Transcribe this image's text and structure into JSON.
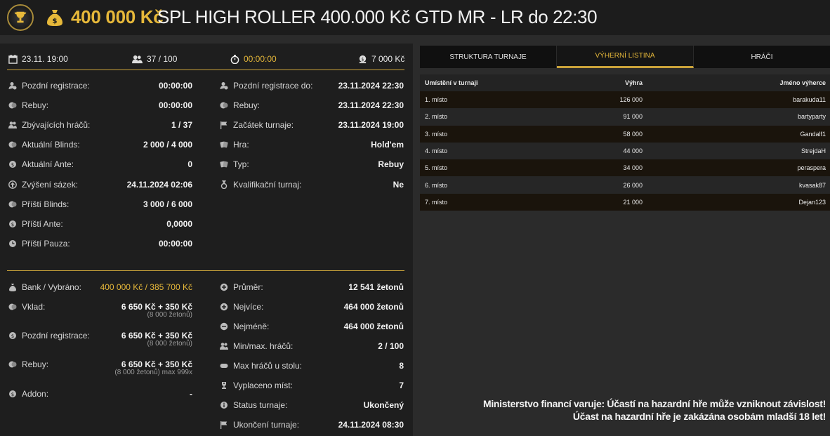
{
  "header": {
    "prize": "400 000 Kč",
    "title": "SPL HIGH ROLLER 400.000 Kč GTD MR - LR do 22:30"
  },
  "topstats": {
    "date": "23.11. 19:00",
    "players": "37 / 100",
    "timer": "00:00:00",
    "buyin": "7 000 Kč"
  },
  "left_col": [
    {
      "label": "Pozdní registrace:",
      "value": "00:00:00",
      "icon": "user-clock-icon"
    },
    {
      "label": "Rebuy:",
      "value": "00:00:00",
      "icon": "coins-icon"
    },
    {
      "label": "Zbývajících hráčů:",
      "value": "1 / 37",
      "icon": "users-icon"
    },
    {
      "label": "Aktuální Blinds:",
      "value": "2 000 / 4 000",
      "icon": "coins-icon"
    },
    {
      "label": "Aktuální Ante:",
      "value": "0",
      "icon": "coin-icon"
    },
    {
      "label": "Zvýšení sázek:",
      "value": "24.11.2024 02:06",
      "icon": "arrow-up-icon"
    },
    {
      "label": "Příští Blinds:",
      "value": "3 000 / 6 000",
      "icon": "coins-icon"
    },
    {
      "label": "Příští Ante:",
      "value": "0,0000",
      "icon": "coin-icon"
    },
    {
      "label": "Příští Pauza:",
      "value": "00:00:00",
      "icon": "clock-icon"
    }
  ],
  "right_col": [
    {
      "label": "Pozdní registrace do:",
      "value": "23.11.2024 22:30",
      "icon": "user-clock-icon"
    },
    {
      "label": "Rebuy:",
      "value": "23.11.2024 22:30",
      "icon": "coins-icon"
    },
    {
      "label": "Začátek turnaje:",
      "value": "23.11.2024 19:00",
      "icon": "flag-icon"
    },
    {
      "label": "Hra:",
      "value": "Hold'em",
      "icon": "cards-icon"
    },
    {
      "label": "Typ:",
      "value": "Rebuy",
      "icon": "cards-icon"
    },
    {
      "label": "Kvalifikační turnaj:",
      "value": "Ne",
      "icon": "medal-icon"
    }
  ],
  "bank": {
    "label": "Bank / Vybráno:",
    "value": "400 000 Kč / 385 700 Kč",
    "vklad_label": "Vklad:",
    "vklad_value": "6 650 Kč + 350 Kč",
    "vklad_sub": "(8 000 žetonů)",
    "late_label": "Pozdní registrace:",
    "late_value": "6 650 Kč + 350 Kč",
    "late_sub": "(8 000 žetonů)",
    "rebuy_label": "Rebuy:",
    "rebuy_value": "6 650 Kč + 350 Kč",
    "rebuy_sub": "(8 000 žetonů) max 999x",
    "addon_label": "Addon:",
    "addon_value": "-"
  },
  "stats2": [
    {
      "label": "Průměr:",
      "value": "12 541 žetonů",
      "icon": "plus-circle-icon"
    },
    {
      "label": "Nejvíce:",
      "value": "464 000 žetonů",
      "icon": "plus-circle-icon"
    },
    {
      "label": "Nejméně:",
      "value": "464 000 žetonů",
      "icon": "minus-circle-icon"
    },
    {
      "label": "Min/max. hráčů:",
      "value": "2 / 100",
      "icon": "users-icon"
    },
    {
      "label": "Max hráčů u stolu:",
      "value": "8",
      "icon": "table-icon"
    },
    {
      "label": "Vyplaceno míst:",
      "value": "7",
      "icon": "trophy-icon"
    },
    {
      "label": "Status turnaje:",
      "value": "Ukončený",
      "icon": "info-icon"
    },
    {
      "label": "Ukončení turnaje:",
      "value": "24.11.2024 08:30",
      "icon": "flag-icon"
    }
  ],
  "tabs": [
    "STRUKTURA TURNAJE",
    "VÝHERNÍ LISTINA",
    "HRÁČI"
  ],
  "payout": {
    "headers": [
      "Umístění v turnaji",
      "Výhra",
      "Jméno výherce"
    ],
    "rows": [
      [
        "1. místo",
        "126 000",
        "barakuda11"
      ],
      [
        "2. místo",
        "91 000",
        "bartyparty"
      ],
      [
        "3. místo",
        "58 000",
        "Gandalf1"
      ],
      [
        "4. místo",
        "44 000",
        "StrejdaH"
      ],
      [
        "5. místo",
        "34 000",
        "peraspera"
      ],
      [
        "6. místo",
        "26 000",
        "kvasak87"
      ],
      [
        "7. místo",
        "21 000",
        "Dejan123"
      ]
    ]
  },
  "warning": {
    "line1": "Ministerstvo financí varuje: Účastí na hazardní hře může vzniknout závislost!",
    "line2": "Účast na hazardní hře je zakázána osobám mladší 18 let!"
  }
}
